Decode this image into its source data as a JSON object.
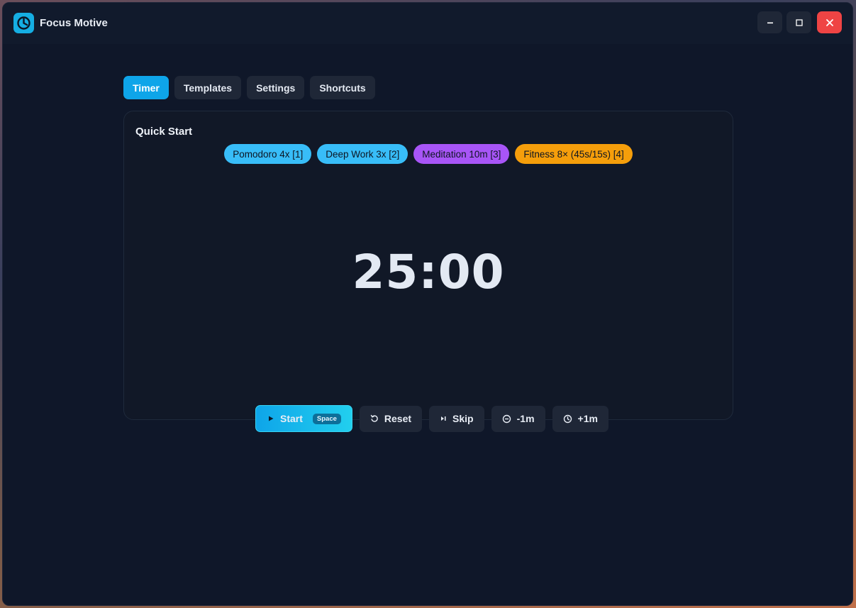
{
  "app": {
    "title": "Focus Motive",
    "icon": "app-clock-icon",
    "accent": "#0ea5e9"
  },
  "window_controls": [
    "minimize-icon",
    "maximize-icon",
    "close-icon"
  ],
  "tabs": [
    {
      "label": "Timer",
      "active": true
    },
    {
      "label": "Templates",
      "active": false
    },
    {
      "label": "Settings",
      "active": false
    },
    {
      "label": "Shortcuts",
      "active": false
    }
  ],
  "quick_start": {
    "title": "Quick Start",
    "presets": [
      {
        "label": "Pomodoro 4x [1]",
        "color": "#38bdf8"
      },
      {
        "label": "Deep Work 3x [2]",
        "color": "#38bdf8"
      },
      {
        "label": "Meditation 10m [3]",
        "color": "#a855f7"
      },
      {
        "label": "Fitness 8× (45s/15s) [4]",
        "color": "#f59e0b"
      }
    ]
  },
  "timer": {
    "display": "25:00"
  },
  "controls": {
    "start": {
      "label": "Start",
      "shortcut": "Space",
      "icon": "play-icon"
    },
    "reset": {
      "label": "Reset",
      "icon": "reset-icon"
    },
    "skip": {
      "label": "Skip",
      "icon": "skip-icon"
    },
    "minus": {
      "label": "-1m",
      "icon": "minus-circle-icon"
    },
    "plus": {
      "label": "+1m",
      "icon": "clock-icon"
    }
  }
}
